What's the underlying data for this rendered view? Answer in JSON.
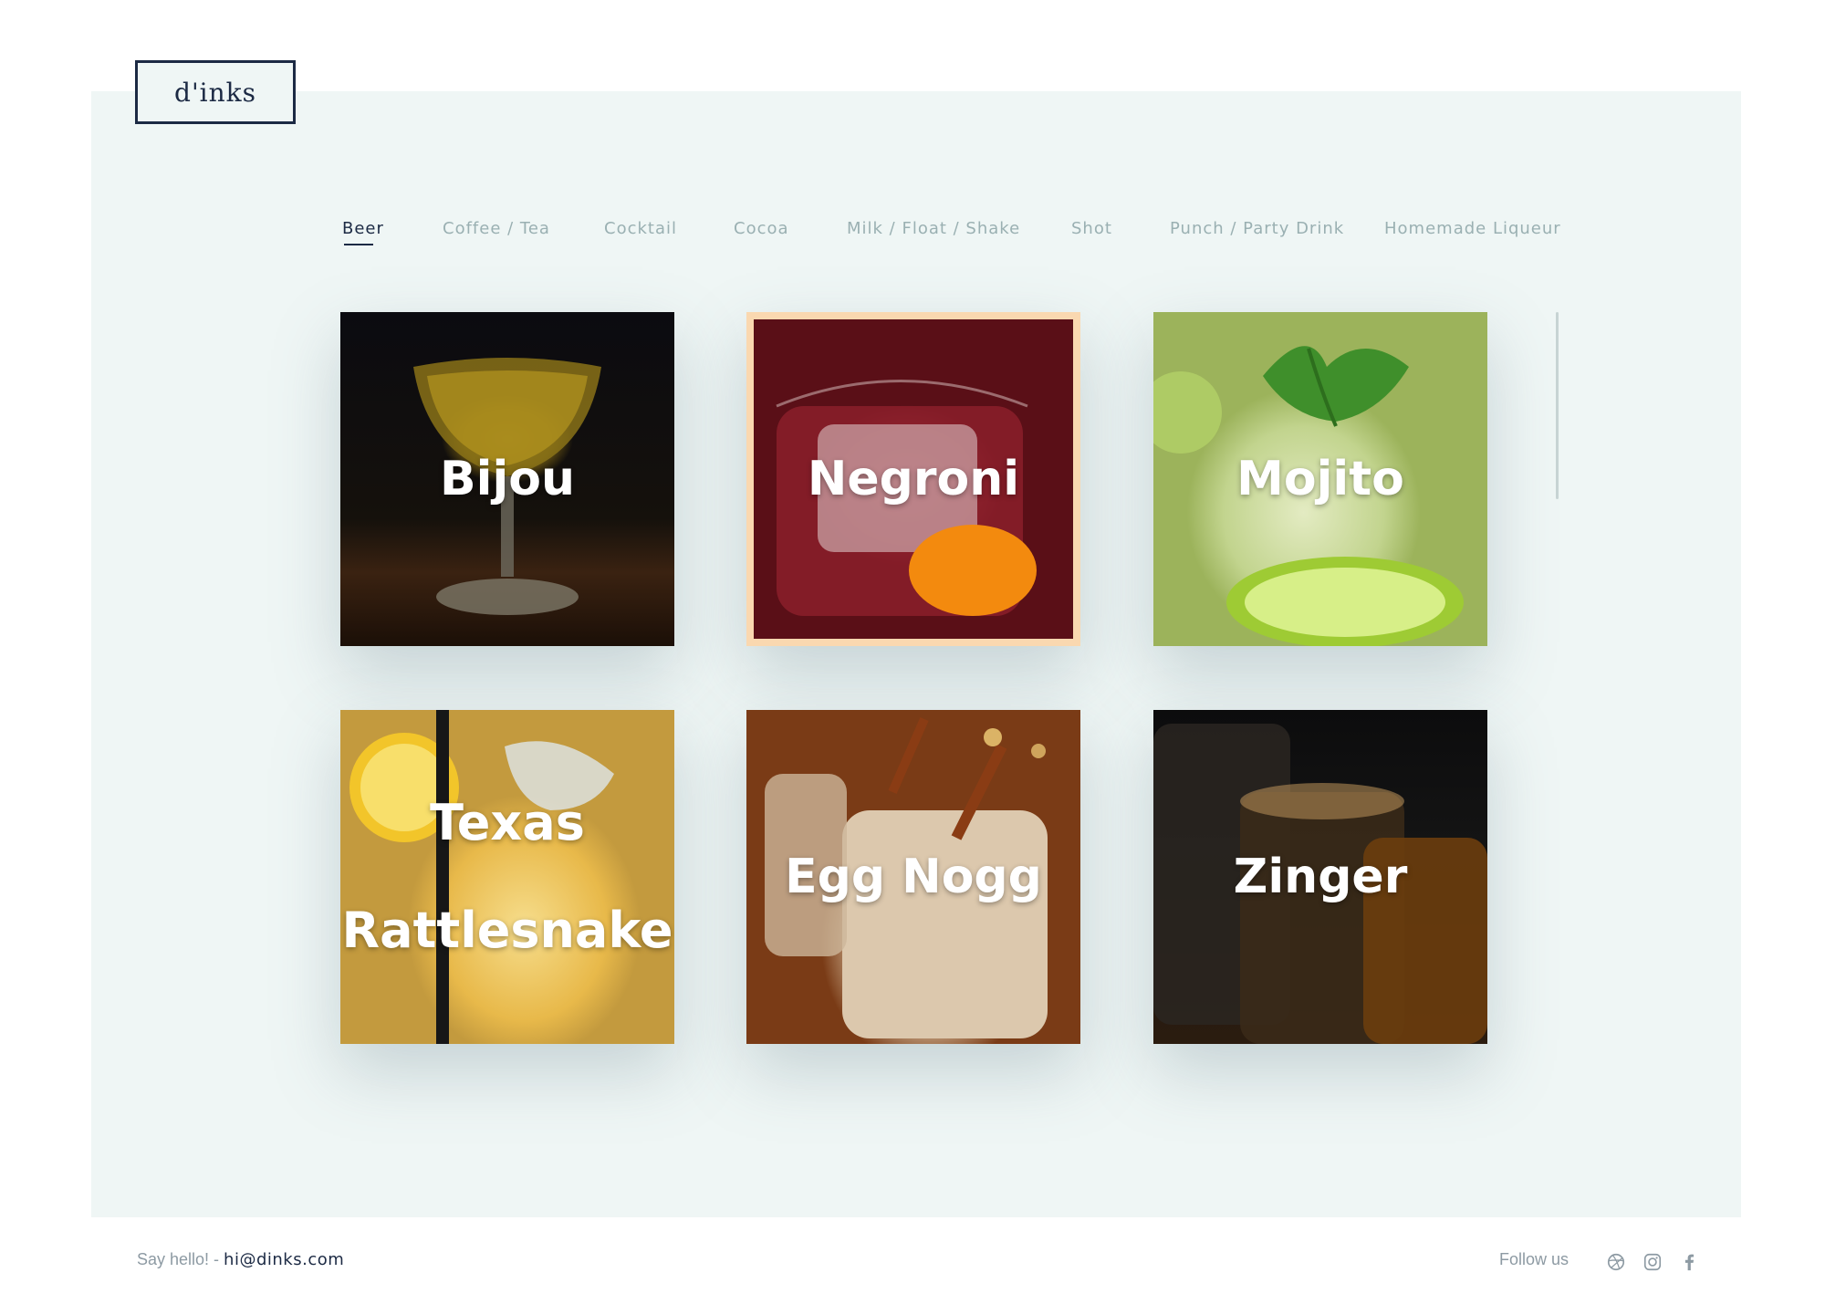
{
  "brand": {
    "logo": "d'inks"
  },
  "nav": {
    "active_index": 0,
    "items": [
      "Beer",
      "Coffee / Tea",
      "Cocktail",
      "Cocoa",
      "Milk / Float / Shake",
      "Shot",
      "Punch / Party Drink",
      "Homemade Liqueur"
    ]
  },
  "drinks": [
    {
      "title": "Bijou",
      "image": "golden cocktail in coupe glass on dark wood"
    },
    {
      "title": "Negroni",
      "image": "red drink with ice cube and orange peel",
      "selected": true
    },
    {
      "title": "Mojito",
      "image": "mint, lime and crushed ice in glass"
    },
    {
      "title": "Texas Rattlesnake",
      "image": "yellow drink with lemon slice and black straw"
    },
    {
      "title": "Egg Nogg",
      "image": "creamy drink with cinnamon sticks"
    },
    {
      "title": "Zinger",
      "image": "three amber shot glasses"
    }
  ],
  "footer": {
    "hello": "Say hello! - ",
    "email": "hi@dinks.com",
    "follow": "Follow us",
    "social_icons": [
      "dribbble-icon",
      "instagram-icon",
      "facebook-icon"
    ]
  },
  "colors": {
    "accent": "#1c2a44",
    "panel": "#eff6f5",
    "selected_border": "#fad8b0",
    "muted": "#9ab0b2"
  }
}
